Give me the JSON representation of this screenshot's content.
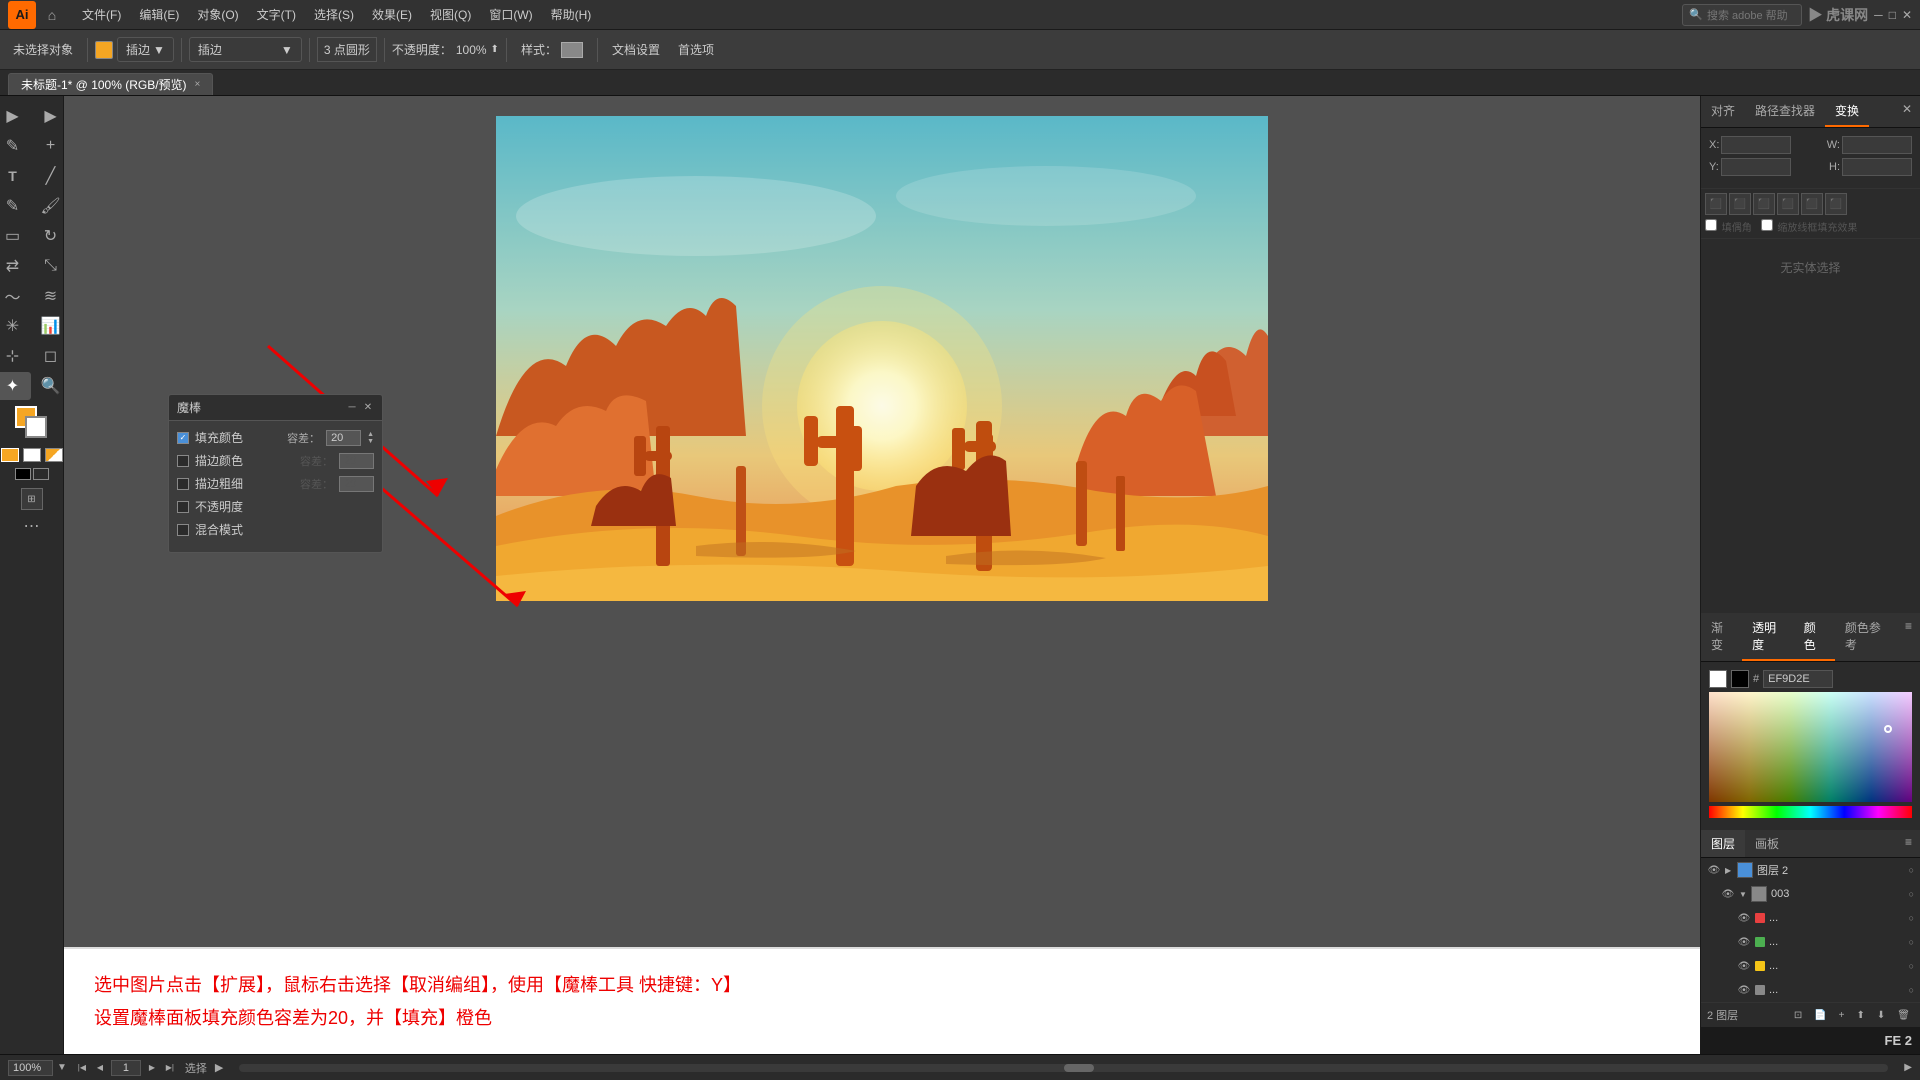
{
  "app": {
    "title": "Adobe Illustrator",
    "logo": "Ai",
    "watermark": "虎课网"
  },
  "top_menu": {
    "items": [
      "文件(F)",
      "编辑(E)",
      "对象(O)",
      "文字(T)",
      "选择(S)",
      "效果(E)",
      "视图(Q)",
      "窗口(W)",
      "帮助(H)"
    ]
  },
  "toolbar": {
    "no_selection": "未选择对象",
    "brush_label": "描边：",
    "brush_mode": "插边",
    "point_count": "3 点圆形",
    "opacity_label": "不透明度：",
    "opacity_value": "100%",
    "style_label": "样式：",
    "doc_setup": "文档设置",
    "preferences": "首选项"
  },
  "tab": {
    "name": "未标题-1* @ 100% (RGB/预览)",
    "close": "×"
  },
  "canvas": {
    "zoom": "100%",
    "page": "1",
    "status": "选择",
    "mode": "选择"
  },
  "magic_wand_panel": {
    "title": "魔棒",
    "fill_color_label": "填充颜色",
    "fill_color_checked": true,
    "fill_tolerance_label": "容差：",
    "fill_tolerance_value": "20",
    "stroke_color_label": "描边颜色",
    "stroke_color_checked": false,
    "stroke_tolerance_label": "容差：",
    "stroke_width_label": "描边粗细",
    "stroke_width_checked": false,
    "opacity_label": "不透明度",
    "opacity_checked": false,
    "blend_mode_label": "混合模式",
    "blend_mode_checked": false
  },
  "right_panel": {
    "tabs": [
      "对齐",
      "路径查找器",
      "变换"
    ],
    "active_tab": "变换",
    "no_selection_msg": "无实体选择"
  },
  "layers_panel": {
    "tabs": [
      "图层",
      "画板"
    ],
    "active_tab": "图层",
    "menu_icon": "≡",
    "layers": [
      {
        "name": "图层 2",
        "visible": true,
        "expanded": true,
        "color": "#4a90d9",
        "active": true,
        "sublayers": [
          {
            "name": "003",
            "visible": true,
            "expanded": false,
            "color": "#888",
            "sublayers": [
              {
                "name": "...",
                "color": "#e84040",
                "visible": true
              },
              {
                "name": "...",
                "color": "#4caf50",
                "visible": true
              },
              {
                "name": "...",
                "color": "#f5c518",
                "visible": true
              },
              {
                "name": "...",
                "color": "#888",
                "visible": true
              }
            ]
          }
        ]
      }
    ],
    "bottom": {
      "layer_count": "2 图层",
      "buttons": [
        "make_clipping",
        "new_sublayer",
        "new_layer",
        "arrange",
        "move",
        "delete"
      ]
    }
  },
  "color_panel": {
    "hex_label": "#",
    "hex_value": "EF9D2E",
    "swatches": [
      "white",
      "black"
    ]
  },
  "instruction": {
    "line1": "选中图片点击【扩展】，鼠标右击选择【取消编组】，使用【魔棒工具 快捷键：Y】",
    "line2": "设置魔棒面板填充颜色容差为20，并【填充】橙色"
  },
  "status_bar": {
    "zoom": "100%",
    "page": "1",
    "status_label": "选择"
  }
}
